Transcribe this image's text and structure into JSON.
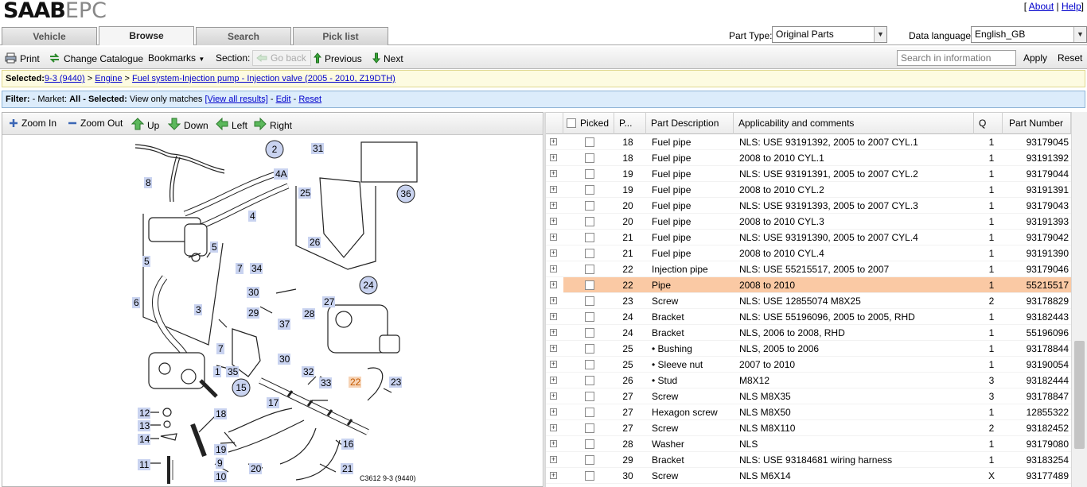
{
  "header": {
    "logo_brand": "SAAB",
    "logo_suffix": "EPC",
    "link_about": "About",
    "link_help": "Help",
    "link_sep": "|",
    "bracket_open": "[",
    "bracket_close": "]"
  },
  "tabs": [
    {
      "label": "Vehicle",
      "active": false
    },
    {
      "label": "Browse",
      "active": true
    },
    {
      "label": "Search",
      "active": false
    },
    {
      "label": "Pick list",
      "active": false
    }
  ],
  "part_type": {
    "label": "Part Type:",
    "value": "Original Parts"
  },
  "data_language": {
    "label": "Data language:",
    "value": "English_GB"
  },
  "toolbar": {
    "print": "Print",
    "change_catalogue": "Change Catalogue",
    "bookmarks": "Bookmarks",
    "section_label": "Section:",
    "go_back": "Go back",
    "previous": "Previous",
    "next": "Next",
    "search_placeholder": "Search in information",
    "apply": "Apply",
    "reset": "Reset"
  },
  "selected": {
    "label": "Selected:",
    "crumbs": [
      "9-3 (9440)",
      "Engine",
      "Fuel system-Injection pump - Injection valve (2005 - 2010, Z19DTH)"
    ],
    "sep": " > "
  },
  "filter": {
    "label": "Filter:",
    "market_text": "- Market:",
    "market_value": "All",
    "selected_text": "- Selected:",
    "selected_value": "View only matches",
    "view_all": "[View all results]",
    "edit": "Edit",
    "reset": "Reset",
    "dash": "-"
  },
  "diagram_toolbar": {
    "zoom_in": "Zoom In",
    "zoom_out": "Zoom Out",
    "up": "Up",
    "down": "Down",
    "left": "Left",
    "right": "Right"
  },
  "diagram": {
    "caption": "C3612 9-3 (9440)",
    "callouts_circled": [
      "2",
      "36",
      "24",
      "15"
    ],
    "callouts": [
      "31",
      "8",
      "4A",
      "25",
      "4",
      "26",
      "5",
      "5",
      "34",
      "7",
      "30",
      "6",
      "29",
      "27",
      "37",
      "28",
      "3",
      "7",
      "30",
      "35",
      "1",
      "32",
      "33",
      "22",
      "23",
      "17",
      "12",
      "13",
      "14",
      "18",
      "19",
      "9",
      "10",
      "11",
      "20",
      "21",
      "16"
    ]
  },
  "table": {
    "headers": {
      "picked": "Picked",
      "pos": "P...",
      "desc": "Part Description",
      "appl": "Applicability and comments",
      "qty": "Q",
      "partno": "Part Number"
    },
    "rows": [
      {
        "pos": "18",
        "desc": "Fuel pipe",
        "appl": "NLS: USE 93191392, 2005 to 2007 CYL.1",
        "qty": "1",
        "partno": "93179045",
        "hl": false
      },
      {
        "pos": "18",
        "desc": "Fuel pipe",
        "appl": "2008 to 2010 CYL.1",
        "qty": "1",
        "partno": "93191392",
        "hl": false
      },
      {
        "pos": "19",
        "desc": "Fuel pipe",
        "appl": "NLS: USE 93191391, 2005 to 2007 CYL.2",
        "qty": "1",
        "partno": "93179044",
        "hl": false
      },
      {
        "pos": "19",
        "desc": "Fuel pipe",
        "appl": "2008 to 2010 CYL.2",
        "qty": "1",
        "partno": "93191391",
        "hl": false
      },
      {
        "pos": "20",
        "desc": "Fuel pipe",
        "appl": "NLS: USE 93191393, 2005 to 2007 CYL.3",
        "qty": "1",
        "partno": "93179043",
        "hl": false
      },
      {
        "pos": "20",
        "desc": "Fuel pipe",
        "appl": "2008 to 2010 CYL.3",
        "qty": "1",
        "partno": "93191393",
        "hl": false
      },
      {
        "pos": "21",
        "desc": "Fuel pipe",
        "appl": "NLS: USE 93191390, 2005 to 2007 CYL.4",
        "qty": "1",
        "partno": "93179042",
        "hl": false
      },
      {
        "pos": "21",
        "desc": "Fuel pipe",
        "appl": "2008 to 2010 CYL.4",
        "qty": "1",
        "partno": "93191390",
        "hl": false
      },
      {
        "pos": "22",
        "desc": "Injection pipe",
        "appl": "NLS: USE 55215517, 2005 to 2007",
        "qty": "1",
        "partno": "93179046",
        "hl": false
      },
      {
        "pos": "22",
        "desc": "Pipe",
        "appl": "2008 to 2010",
        "qty": "1",
        "partno": "55215517",
        "hl": true
      },
      {
        "pos": "23",
        "desc": "Screw",
        "appl": "NLS: USE 12855074 M8X25",
        "qty": "2",
        "partno": "93178829",
        "hl": false
      },
      {
        "pos": "24",
        "desc": "Bracket",
        "appl": "NLS: USE 55196096, 2005 to 2005, RHD",
        "qty": "1",
        "partno": "93182443",
        "hl": false
      },
      {
        "pos": "24",
        "desc": "Bracket",
        "appl": "NLS, 2006 to 2008, RHD",
        "qty": "1",
        "partno": "55196096",
        "hl": false
      },
      {
        "pos": "25",
        "desc": "• Bushing",
        "appl": "NLS, 2005 to 2006",
        "qty": "1",
        "partno": "93178844",
        "hl": false
      },
      {
        "pos": "25",
        "desc": "• Sleeve nut",
        "appl": "2007 to 2010",
        "qty": "1",
        "partno": "93190054",
        "hl": false
      },
      {
        "pos": "26",
        "desc": "• Stud",
        "appl": "M8X12",
        "qty": "3",
        "partno": "93182444",
        "hl": false
      },
      {
        "pos": "27",
        "desc": "Screw",
        "appl": "NLS M8X35",
        "qty": "3",
        "partno": "93178847",
        "hl": false
      },
      {
        "pos": "27",
        "desc": "Hexagon screw",
        "appl": "NLS M8X50",
        "qty": "1",
        "partno": "12855322",
        "hl": false
      },
      {
        "pos": "27",
        "desc": "Screw",
        "appl": "NLS M8X110",
        "qty": "2",
        "partno": "93182452",
        "hl": false
      },
      {
        "pos": "28",
        "desc": "Washer",
        "appl": "NLS",
        "qty": "1",
        "partno": "93179080",
        "hl": false
      },
      {
        "pos": "29",
        "desc": "Bracket",
        "appl": "NLS: USE 93184681 wiring harness",
        "qty": "1",
        "partno": "93183254",
        "hl": false
      },
      {
        "pos": "30",
        "desc": "Screw",
        "appl": "NLS M6X14",
        "qty": "X",
        "partno": "93177489",
        "hl": false
      }
    ]
  },
  "colors": {
    "highlight_row": "#fac9a4",
    "link": "#0000cc",
    "selected_bar": "#fdfbe1",
    "filter_bar": "#dcecfb",
    "callout_circle": "#c9d3f0"
  }
}
